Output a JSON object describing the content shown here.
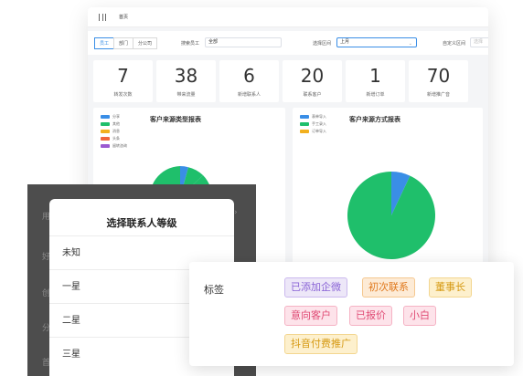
{
  "dashboard": {
    "breadcrumb": "首页",
    "seg_tabs": [
      "员工",
      "部门",
      "分公司"
    ],
    "staff_filter_label": "搜索员工",
    "staff_filter_value": "全部",
    "interval_label": "选择区间",
    "interval_value": "上月",
    "custom_label": "自定义区间",
    "custom_placeholder": "选择",
    "stats": [
      {
        "value": "7",
        "label": "转发次数"
      },
      {
        "value": "38",
        "label": "带来流量"
      },
      {
        "value": "6",
        "label": "新增联系人"
      },
      {
        "value": "20",
        "label": "联系客户"
      },
      {
        "value": "1",
        "label": "新增订单"
      },
      {
        "value": "70",
        "label": "新增推广音"
      }
    ],
    "left_panel": {
      "title": "客户来源类型报表",
      "legend": [
        {
          "label": "分享",
          "color": "#3a8ee6"
        },
        {
          "label": "其他",
          "color": "#1fbf6b"
        },
        {
          "label": "消息",
          "color": "#f2b01e"
        },
        {
          "label": "头条",
          "color": "#f0653c"
        },
        {
          "label": "留转咨询",
          "color": "#9b59d0"
        }
      ]
    },
    "right_panel": {
      "title": "客户来源方式报表",
      "legend": [
        {
          "label": "表单导入",
          "color": "#3a8ee6"
        },
        {
          "label": "手工录入",
          "color": "#1fbf6b"
        },
        {
          "label": "订单导入",
          "color": "#f2b01e"
        }
      ]
    }
  },
  "chart_data": [
    {
      "type": "pie",
      "title": "客户来源方式报表",
      "categories": [
        "表单导入",
        "手工录入",
        "订单导入"
      ],
      "values": [
        7,
        93,
        0
      ],
      "colors": [
        "#3a8ee6",
        "#1fbf6b",
        "#f2b01e"
      ]
    }
  ],
  "overlay": {
    "ghost_texts": [
      "用",
      "好",
      "创",
      "分",
      "首"
    ]
  },
  "level_sheet": {
    "title": "选择联系人等级",
    "options": [
      "未知",
      "一星",
      "二星",
      "三星"
    ]
  },
  "tag_card": {
    "label": "标签",
    "tags": [
      {
        "text": "已添加企微",
        "style": "purple"
      },
      {
        "text": "初次联系",
        "style": "orange"
      },
      {
        "text": "董事长",
        "style": "yellow"
      },
      {
        "text": "意向客户",
        "style": "pink"
      },
      {
        "text": "已报价",
        "style": "pink"
      },
      {
        "text": "小白",
        "style": "pink"
      },
      {
        "text": "抖音付费推广",
        "style": "yellow"
      }
    ]
  }
}
